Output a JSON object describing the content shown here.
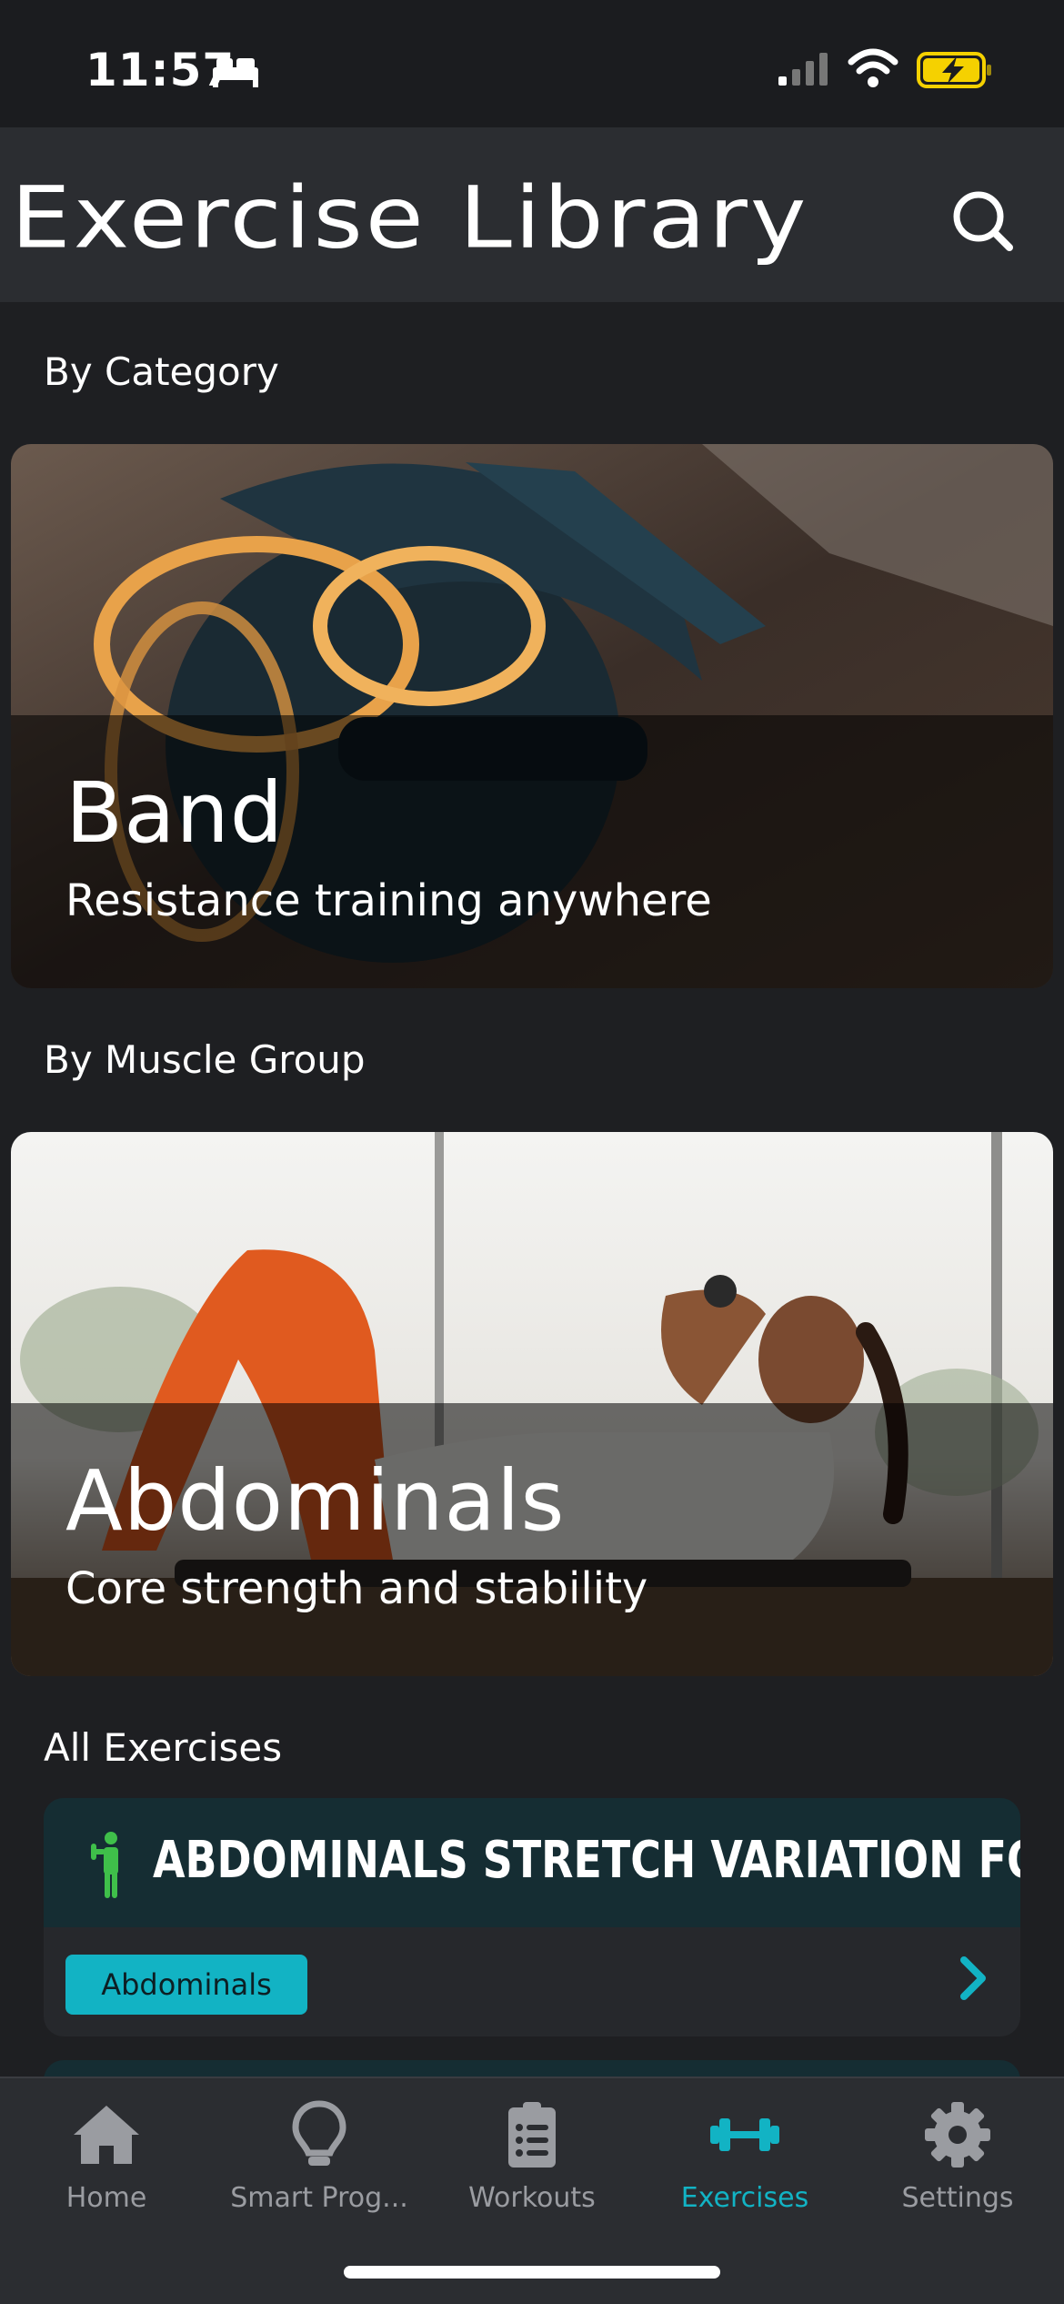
{
  "status_bar": {
    "time": "11:57"
  },
  "header": {
    "title": "Exercise Library"
  },
  "sections": {
    "by_category": "By Category",
    "by_muscle_group": "By Muscle Group",
    "all_exercises": "All Exercises"
  },
  "category_card": {
    "title": "Band",
    "subtitle": "Resistance training anywhere"
  },
  "muscle_card": {
    "title": "Abdominals",
    "subtitle": "Core strength and stability"
  },
  "exercises": [
    {
      "name": "ABDOMINALS STRETCH VARIATION FOUR",
      "muscle": "Abdominals"
    }
  ],
  "tabs": [
    {
      "label": "Home",
      "icon": "home-icon"
    },
    {
      "label": "Smart Prog...",
      "icon": "lightbulb-icon"
    },
    {
      "label": "Workouts",
      "icon": "clipboard-list-icon"
    },
    {
      "label": "Exercises",
      "icon": "dumbbell-icon",
      "active": true
    },
    {
      "label": "Settings",
      "icon": "gear-icon"
    }
  ],
  "colors": {
    "accent": "#12b3c4",
    "background": "#1e1f22",
    "header": "#2b2d31",
    "exercise_header": "#152d33",
    "person_icon": "#3fbf4a",
    "battery": "#f5d100"
  }
}
